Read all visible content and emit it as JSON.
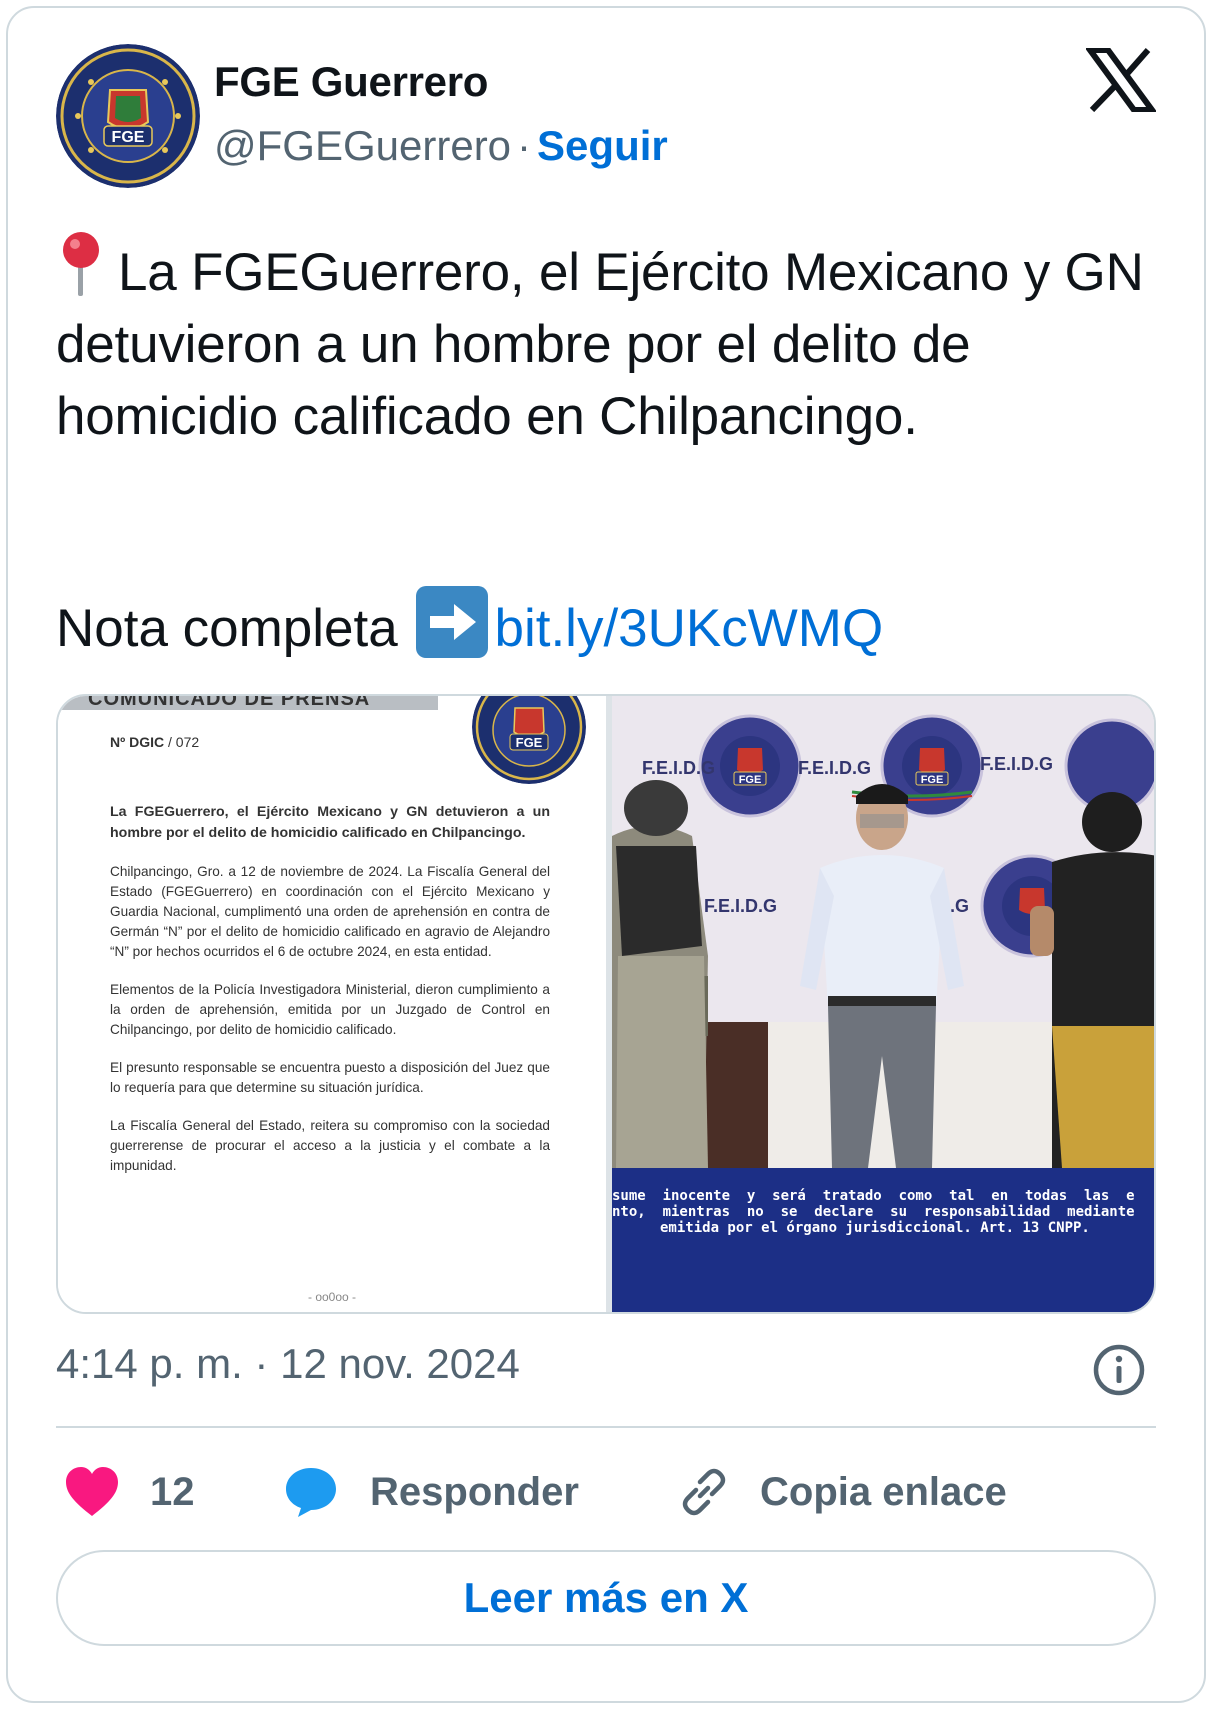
{
  "author": {
    "name": "FGE Guerrero",
    "handle": "@FGEGuerrero",
    "separator": "·",
    "follow_label": "Seguir",
    "avatar_icon": "fge-seal-logo"
  },
  "brand_logo": "x-logo-icon",
  "tweet": {
    "pin_emoji": "round-pushpin-icon",
    "text": "La FGEGuerrero, el Ejército Mexicano y GN detuvieron a un hombre por el delito de homicidio calificado en Chilpancingo.",
    "nota_label": "Nota completa",
    "arrow_emoji": "right-arrow-icon",
    "link_text": "bit.ly/3UKcWMQ"
  },
  "media": {
    "document": {
      "header_clipped": "COMUNICADO DE PRENSA",
      "number_label": "Nº DGIC",
      "number_value": "/ 072",
      "headline": "La FGEGuerrero, el Ejército Mexicano y GN detuvieron a un hombre por el delito de homicidio calificado en Chilpancingo.",
      "paragraphs": [
        "Chilpancingo, Gro. a 12 de noviembre de 2024. La Fiscalía General del Estado (FGEGuerrero) en coordinación con el Ejército Mexicano y Guardia Nacional, cumplimentó una orden de aprehensión en contra de Germán “N” por el delito de homicidio calificado en agravio de Alejandro “N” por hechos ocurridos el 6 de octubre 2024, en esta entidad.",
        "Elementos de la Policía Investigadora Ministerial, dieron cumplimiento a la orden de aprehensión, emitida por un Juzgado de Control en Chilpancingo, por delito de homicidio calificado.",
        "El presunto responsable se encuentra puesto a disposición del Juez que lo requería para que determine su situación jurídica.",
        "La Fiscalía General del Estado, reitera su compromiso con la sociedad guerrerense de procurar el acceso a la justicia y el combate a la impunidad."
      ],
      "footer": "- oo0oo -"
    },
    "photo": {
      "banner_label": "F.E.I.D.G",
      "seal_text": "FGE",
      "caption_line1": "sume  inocente  y  será  tratado  como  tal  en  todas  las  e",
      "caption_line2": "nto,  mientras  no  se  declare  su  responsabilidad  mediante",
      "caption_line3": "emitida por el órgano jurisdiccional. Art. 13 CNPP."
    }
  },
  "timestamp": "4:14 p. m. · 12 nov. 2024",
  "actions": {
    "likes_count": "12",
    "reply_label": "Responder",
    "copy_label": "Copia enlace"
  },
  "read_more_label": "Leer más en X",
  "colors": {
    "link": "#006fd6",
    "muted": "#536471",
    "border": "#cfd9de",
    "heart": "#f91880",
    "reply_bubble": "#1d9bf0",
    "seal_blue": "#1c2f86"
  }
}
